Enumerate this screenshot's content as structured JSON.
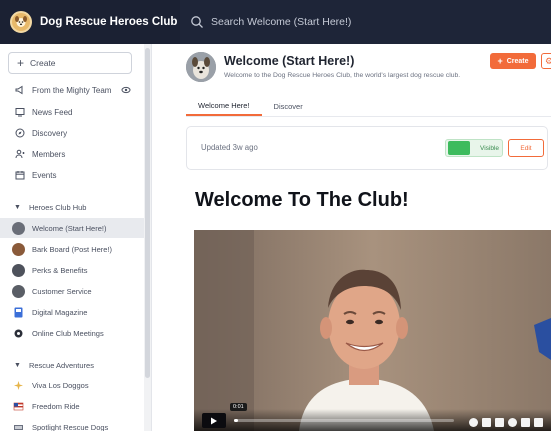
{
  "app": {
    "name": "Dog Rescue Heroes Club",
    "search_placeholder": "Search Welcome (Start Here!)"
  },
  "sidebar": {
    "create_label": "Create",
    "nav": [
      {
        "label": "From the Mighty Team",
        "icon": "megaphone-icon"
      },
      {
        "label": "News Feed",
        "icon": "feed-icon"
      },
      {
        "label": "Discovery",
        "icon": "compass-icon"
      },
      {
        "label": "Members",
        "icon": "members-icon"
      },
      {
        "label": "Events",
        "icon": "calendar-icon"
      }
    ],
    "sections": [
      {
        "title": "Heroes Club Hub",
        "items": [
          {
            "label": "Welcome (Start Here!)",
            "active": true
          },
          {
            "label": "Bark Board (Post Here!)"
          },
          {
            "label": "Perks & Benefits"
          },
          {
            "label": "Customer Service"
          },
          {
            "label": "Digital Magazine"
          },
          {
            "label": "Online Club Meetings"
          }
        ]
      },
      {
        "title": "Rescue Adventures",
        "items": [
          {
            "label": "Viva Los Doggos"
          },
          {
            "label": "Freedom Ride"
          },
          {
            "label": "Spotlight Rescue Dogs"
          }
        ]
      }
    ]
  },
  "page": {
    "title": "Welcome (Start Here!)",
    "subtitle": "Welcome to the Dog Rescue Heroes Club, the world's largest dog rescue club.",
    "create_label": "Create",
    "tabs": [
      "Welcome Here!",
      "Discover"
    ],
    "active_tab": "Welcome Here!",
    "updated": "Updated 3w ago",
    "visible_label": "Visible",
    "edit_label": "Edit",
    "headline": "Welcome To The Club!"
  },
  "video": {
    "time": "0:01",
    "progress": 0.02
  },
  "colors": {
    "topbar": "#1e2538",
    "accent": "#f26b3a",
    "visible": "#3dbb5d"
  }
}
